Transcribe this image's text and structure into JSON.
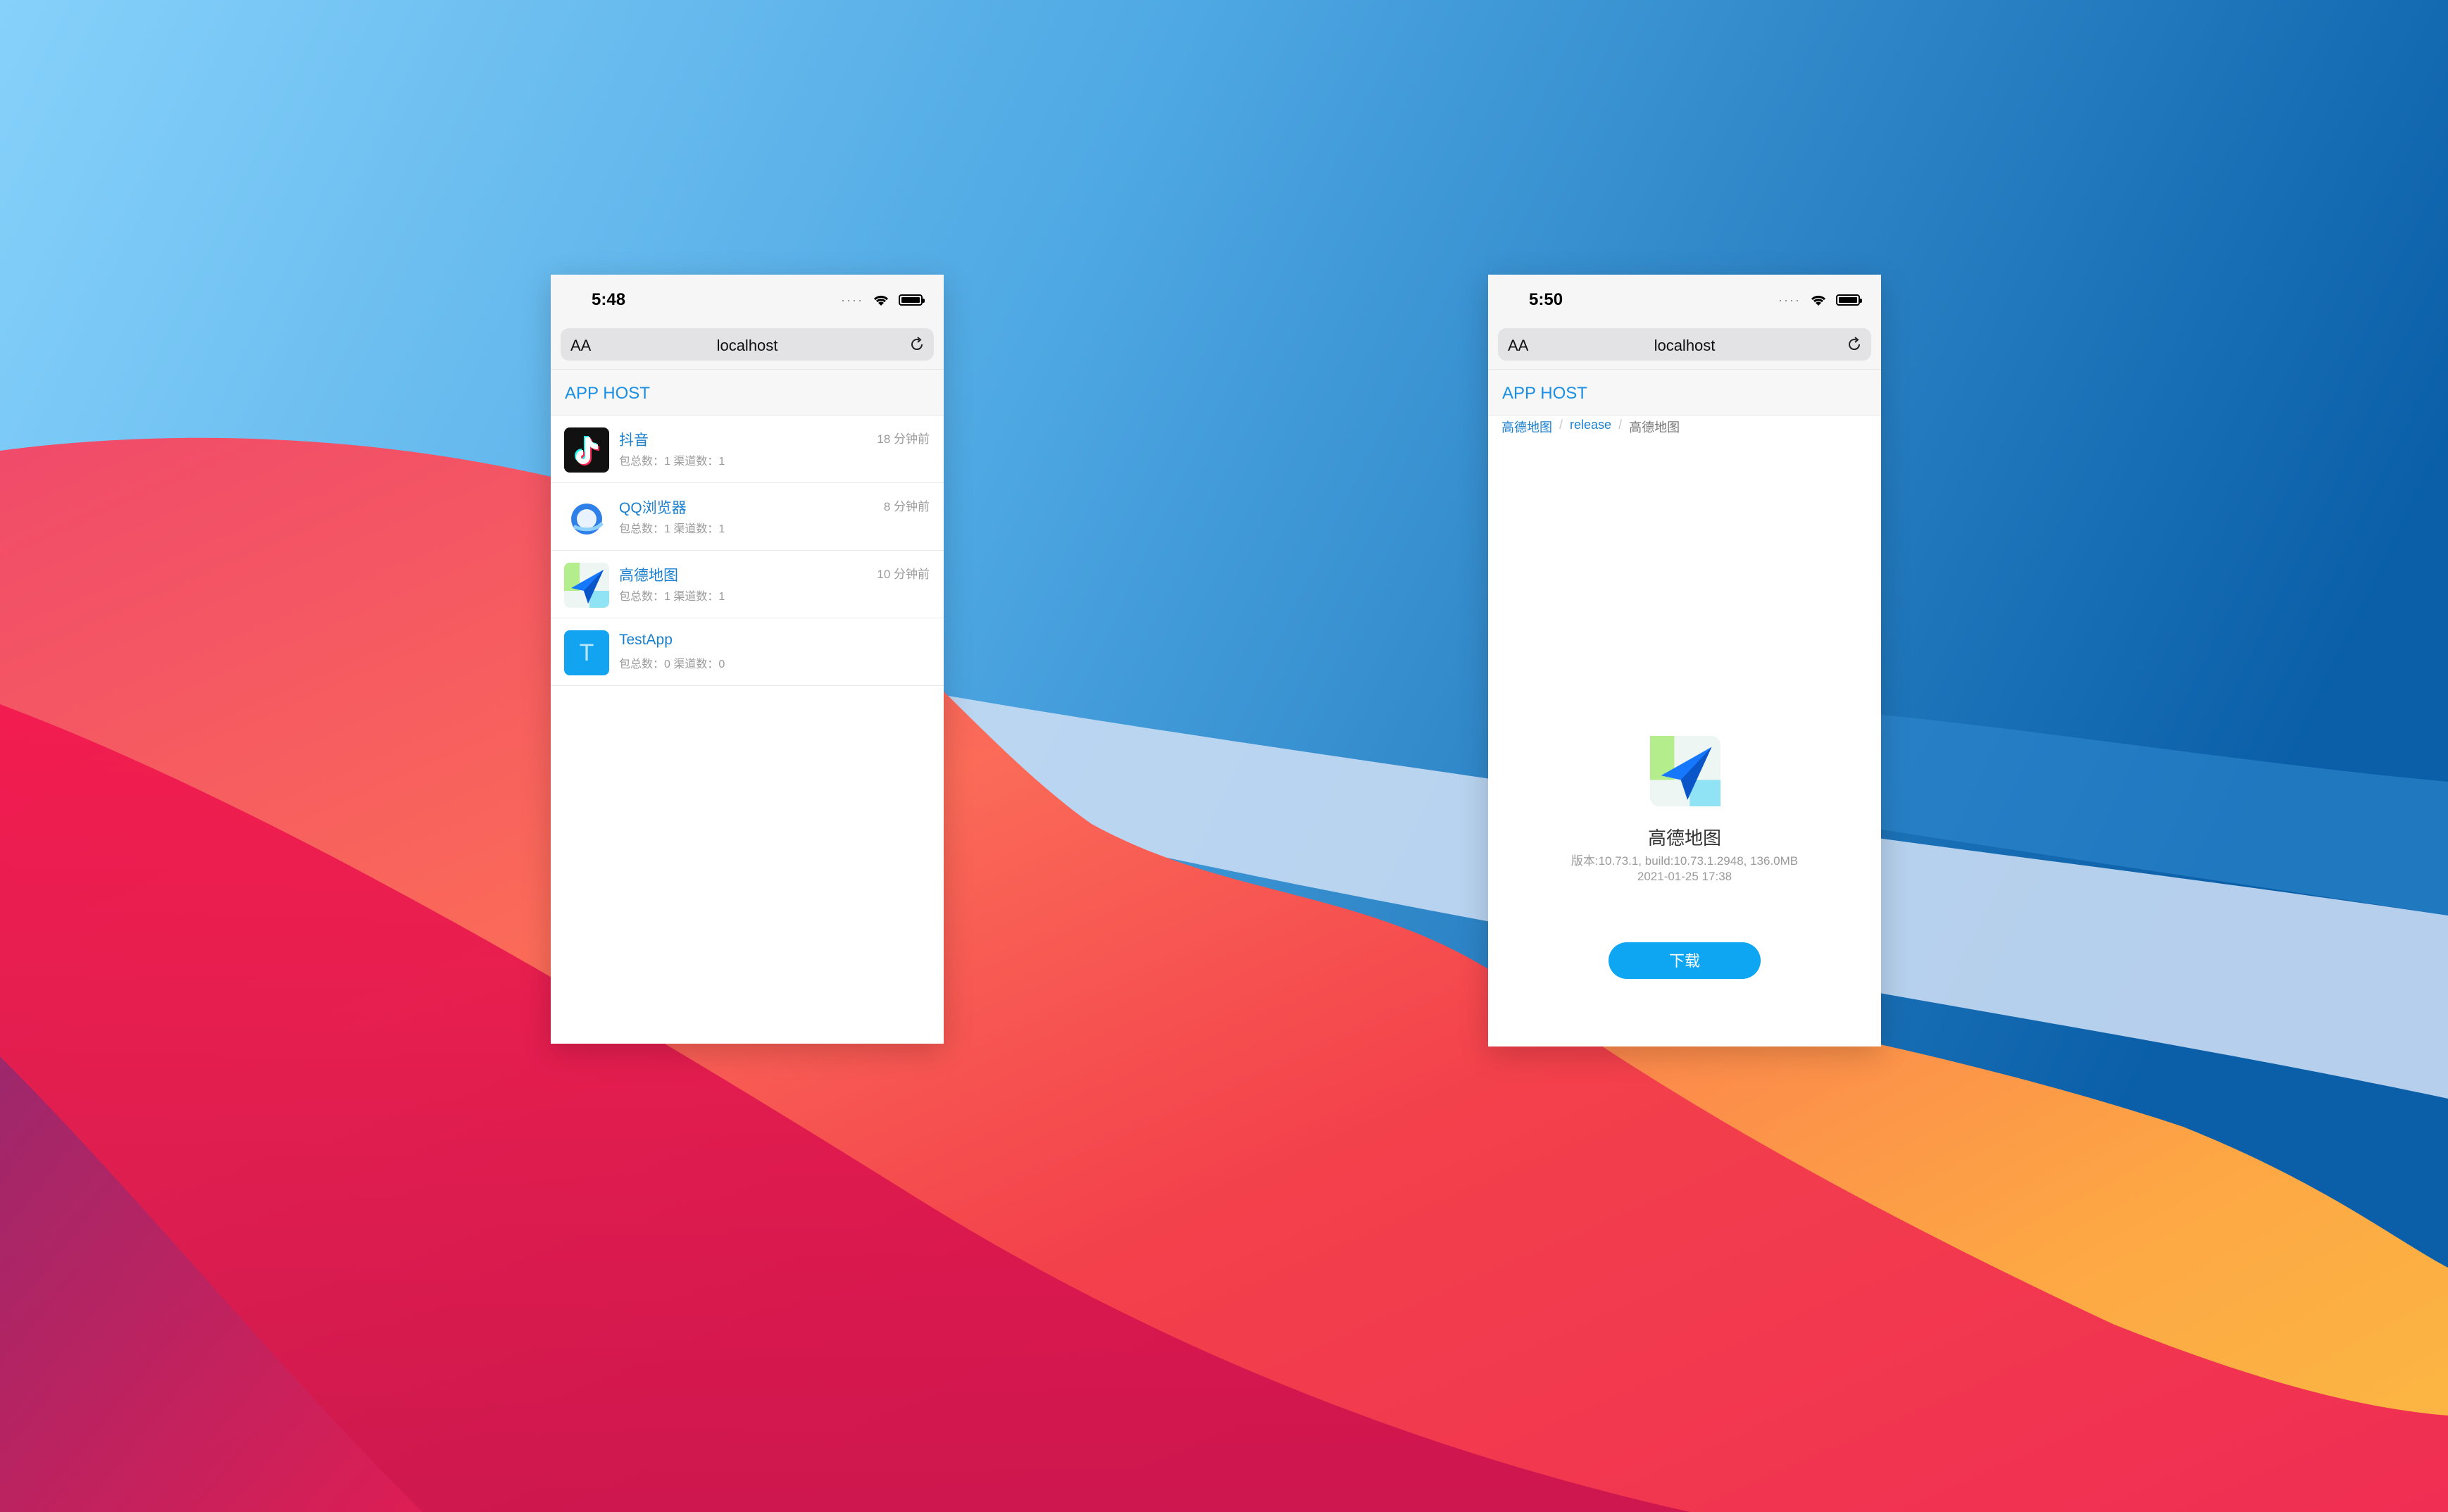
{
  "left_phone": {
    "status_time": "5:48",
    "url": "localhost",
    "aa_label": "AA",
    "app_title": "APP HOST",
    "apps": [
      {
        "name": "抖音",
        "meta": "包总数：1 渠道数：1",
        "time": "18 分钟前",
        "icon": "douyin-icon"
      },
      {
        "name": "QQ浏览器",
        "meta": "包总数：1 渠道数：1",
        "time": "8 分钟前",
        "icon": "qq-browser-icon"
      },
      {
        "name": "高德地图",
        "meta": "包总数：1 渠道数：1",
        "time": "10 分钟前",
        "icon": "amap-icon"
      },
      {
        "name": "TestApp",
        "meta": "包总数：0 渠道数：0",
        "time": "",
        "icon": "testapp-icon",
        "icon_letter": "T"
      }
    ]
  },
  "right_phone": {
    "status_time": "5:50",
    "url": "localhost",
    "aa_label": "AA",
    "app_title": "APP HOST",
    "breadcrumb": {
      "items": [
        "高德地图",
        "release",
        "高德地图"
      ],
      "separator": "/"
    },
    "detail": {
      "name": "高德地图",
      "meta": "版本:10.73.1, build:10.73.1.2948, 136.0MB",
      "date": "2021-01-25 17:38",
      "download_label": "下载"
    }
  },
  "colors": {
    "accent": "#1a8fe3",
    "download_button": "#0ea5f3"
  }
}
